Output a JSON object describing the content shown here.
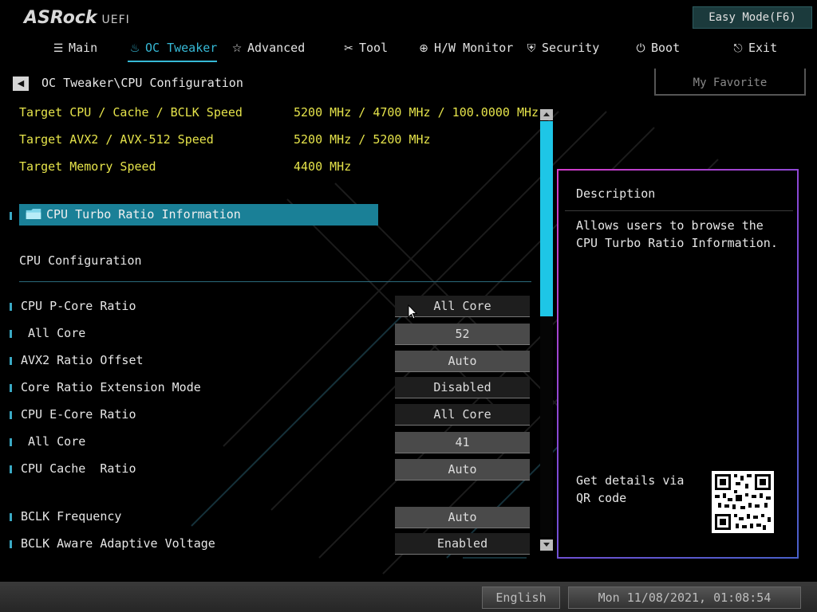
{
  "header": {
    "brand": "ASRock",
    "uefi": "UEFI",
    "easy_mode": "Easy Mode(F6)"
  },
  "tabs": [
    {
      "label": "Main",
      "icon": "list-icon"
    },
    {
      "label": "OC Tweaker",
      "icon": "flame-icon",
      "active": true
    },
    {
      "label": "Advanced",
      "icon": "star-icon"
    },
    {
      "label": "Tool",
      "icon": "tools-icon"
    },
    {
      "label": "H/W Monitor",
      "icon": "monitor-icon"
    },
    {
      "label": "Security",
      "icon": "shield-icon"
    },
    {
      "label": "Boot",
      "icon": "power-icon"
    },
    {
      "label": "Exit",
      "icon": "exit-icon"
    }
  ],
  "breadcrumb": "OC Tweaker\\CPU Configuration",
  "my_favorite": "My Favorite",
  "targets": [
    {
      "label": "Target CPU / Cache / BCLK Speed",
      "value": "5200 MHz / 4700 MHz / 100.0000 MHz"
    },
    {
      "label": "Target AVX2 / AVX-512 Speed",
      "value": "5200 MHz / 5200 MHz"
    },
    {
      "label": "Target Memory Speed",
      "value": "4400 MHz"
    }
  ],
  "turbo_item": "CPU Turbo Ratio Information",
  "section_title": "CPU Configuration",
  "items": [
    {
      "label": "CPU P-Core Ratio",
      "value": "All Core"
    },
    {
      "label": " All Core",
      "value": "52"
    },
    {
      "label": "AVX2 Ratio Offset",
      "value": "Auto"
    },
    {
      "label": "Core Ratio Extension Mode",
      "value": "Disabled"
    },
    {
      "label": "CPU E-Core Ratio",
      "value": "All Core"
    },
    {
      "label": " All Core",
      "value": "41"
    },
    {
      "label": "CPU Cache  Ratio",
      "value": "Auto"
    },
    {
      "label": "BCLK Frequency",
      "value": "Auto"
    },
    {
      "label": "BCLK Aware Adaptive Voltage",
      "value": "Enabled"
    }
  ],
  "description": {
    "title": "Description",
    "text": "Allows users to browse the CPU Turbo Ratio Information.",
    "qr_text": "Get details via QR code"
  },
  "footer": {
    "language": "English",
    "datetime": "Mon 11/08/2021, 01:08:54"
  },
  "colors": {
    "accent": "#36b9d6",
    "target_text": "#e5e34a",
    "selected_item": "#1a8097",
    "scrollbar": "#1ec6e6"
  }
}
